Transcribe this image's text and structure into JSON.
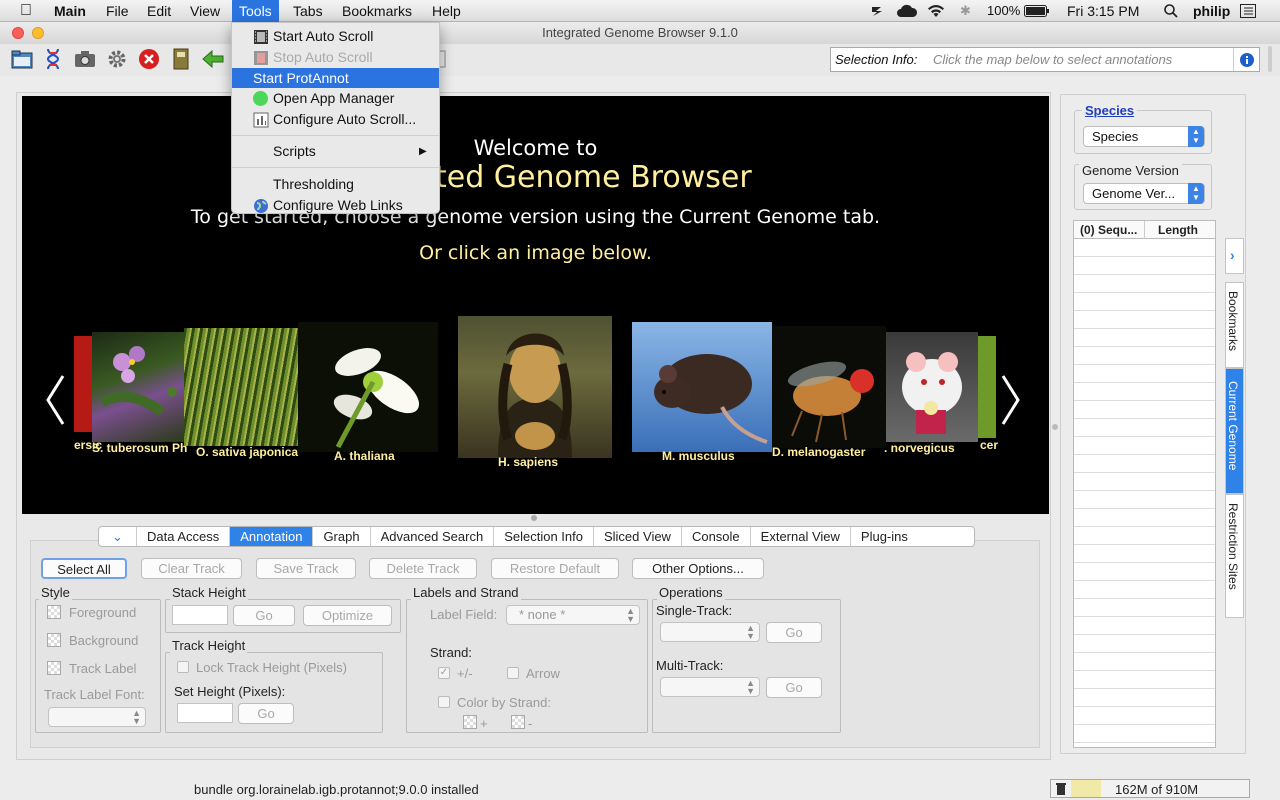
{
  "menubar": {
    "app": "Main",
    "items": [
      "File",
      "Edit",
      "View",
      "Tools",
      "Tabs",
      "Bookmarks",
      "Help"
    ],
    "active": "Tools",
    "battery": "100%",
    "clock": "Fri 3:15 PM",
    "user": "philip"
  },
  "window": {
    "title": "Integrated Genome Browser 9.1.0"
  },
  "selection_info": {
    "label": "Selection Info:",
    "placeholder": "Click the map below to select annotations"
  },
  "tools_menu": {
    "items": [
      {
        "label": "Start Auto Scroll",
        "icon": "film-icon"
      },
      {
        "label": "Stop Auto Scroll",
        "icon": "film-icon",
        "disabled": true
      },
      {
        "label": "Start ProtAnnot",
        "highlighted": true
      },
      {
        "label": "Open App Manager",
        "icon": "green-circle-icon"
      },
      {
        "label": "Configure Auto Scroll...",
        "icon": "config-icon"
      },
      {
        "label": "Scripts",
        "submenu": true
      },
      {
        "label": "Thresholding"
      },
      {
        "label": "Configure Web Links",
        "icon": "globe-icon"
      }
    ]
  },
  "welcome": {
    "line1": "Welcome to",
    "line2_visible": "ted Genome Browser",
    "line3": "To get started, choose a genome version using the Current Genome tab.",
    "line4": "Or click an image below."
  },
  "carousel": [
    {
      "caption": "ersic"
    },
    {
      "caption": "S. tuberosum Ph"
    },
    {
      "caption": "O. sativa japonica"
    },
    {
      "caption": "A. thaliana"
    },
    {
      "caption": "H. sapiens"
    },
    {
      "caption": "M. musculus"
    },
    {
      "caption": "D. melanogaster"
    },
    {
      "caption": ". norvegicus"
    },
    {
      "caption": "cer"
    }
  ],
  "tabs": [
    "Data Access",
    "Annotation",
    "Graph",
    "Advanced Search",
    "Selection Info",
    "Sliced View",
    "Console",
    "External View",
    "Plug-ins"
  ],
  "selected_tab": "Annotation",
  "annotation": {
    "buttons": {
      "select_all": "Select All",
      "clear_track": "Clear Track",
      "save_track": "Save Track",
      "delete_track": "Delete Track",
      "restore_default": "Restore Default",
      "other_options": "Other Options..."
    },
    "style": {
      "title": "Style",
      "foreground": "Foreground",
      "background": "Background",
      "track_label": "Track Label",
      "track_label_font": "Track Label Font:"
    },
    "stack_height": {
      "title": "Stack Height",
      "go": "Go",
      "optimize": "Optimize"
    },
    "track_height": {
      "title": "Track Height",
      "lock": "Lock Track Height (Pixels)",
      "set_height": "Set Height (Pixels):",
      "go": "Go"
    },
    "labels_strand": {
      "title": "Labels and Strand",
      "label_field": "Label Field:",
      "label_field_value": "* none *",
      "strand": "Strand:",
      "plus_minus": "+/-",
      "arrow": "Arrow",
      "color_by_strand": "Color by Strand:",
      "plus": "+",
      "minus": "-"
    },
    "operations": {
      "title": "Operations",
      "single": "Single-Track:",
      "multi": "Multi-Track:",
      "go": "Go"
    }
  },
  "right_panel": {
    "species_title": "Species",
    "species_value": "Species",
    "genome_title": "Genome Version",
    "genome_value": "Genome Ver...",
    "table_headers": [
      "(0) Sequ...",
      "Length"
    ],
    "side_tabs": [
      "Bookmarks",
      "Current Genome",
      "Restriction Sites"
    ]
  },
  "status": {
    "message": "bundle org.lorainelab.igb.protannot;9.0.0 installed",
    "memory": "162M of 910M"
  },
  "colors": {
    "accent": "#2b73df",
    "caption": "#ffef9f"
  }
}
